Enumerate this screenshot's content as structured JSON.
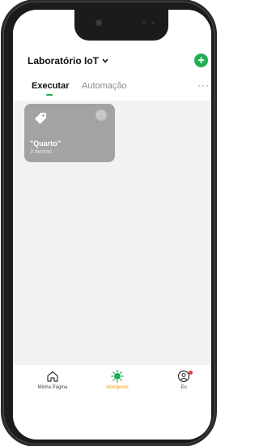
{
  "header": {
    "home_name": "Laboratório IoT",
    "add_symbol": "+",
    "more_symbol": "···"
  },
  "tabs": [
    {
      "label": "Executar",
      "active": true
    },
    {
      "label": "Automação",
      "active": false
    }
  ],
  "scenes": [
    {
      "name": "\"Quarto\"",
      "subtitle": "3 tarefas",
      "more_symbol": "···",
      "icon": "tag-icon",
      "color": "#a1a4a0"
    }
  ],
  "bottom_nav": [
    {
      "label": "Minha Página",
      "icon": "home-icon",
      "active": false
    },
    {
      "label": "Inteligente",
      "icon": "smart-icon",
      "active": true
    },
    {
      "label": "Eu",
      "icon": "profile-icon",
      "active": false,
      "badge": true
    }
  ],
  "colors": {
    "accent_green": "#1fae55",
    "active_nav": "#f0a11e",
    "badge": "#e83a3a"
  }
}
